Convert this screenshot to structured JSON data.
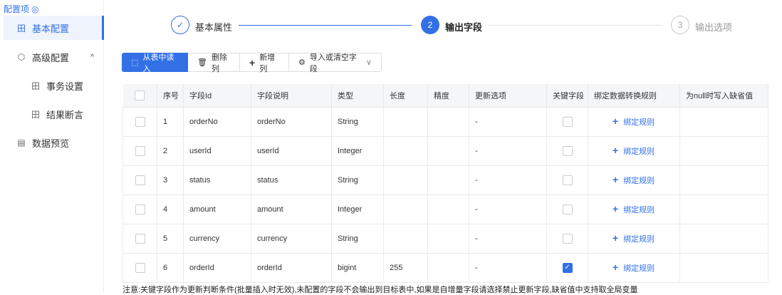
{
  "sidebar": {
    "title": "配置项",
    "items": [
      {
        "label": "基本配置",
        "icon": "grid-icon"
      },
      {
        "label": "高级配置",
        "icon": "cube-icon"
      },
      {
        "label": "事务设置",
        "icon": "grid-icon"
      },
      {
        "label": "结果断言",
        "icon": "grid-icon"
      },
      {
        "label": "数据预览",
        "icon": "preview-icon"
      }
    ]
  },
  "steps": [
    {
      "num": "✓",
      "label": "基本属性",
      "state": "done"
    },
    {
      "num": "2",
      "label": "输出字段",
      "state": "active"
    },
    {
      "num": "3",
      "label": "输出选项",
      "state": "pending"
    }
  ],
  "toolbar": {
    "read": "从表中读入",
    "delete": "删除列",
    "add": "新增列",
    "import": "导入或清空字段"
  },
  "table": {
    "headers": [
      "序号",
      "字段Id",
      "字段说明",
      "类型",
      "长度",
      "精度",
      "更新选项",
      "关键字段",
      "绑定数据转换规则",
      "为null时写入缺省值"
    ],
    "bind_label": "绑定规则",
    "rows": [
      {
        "no": "1",
        "id": "orderNo",
        "desc": "orderNo",
        "type": "String",
        "len": "",
        "prec": "",
        "update": "-",
        "key": false
      },
      {
        "no": "2",
        "id": "userId",
        "desc": "userId",
        "type": "Integer",
        "len": "",
        "prec": "",
        "update": "-",
        "key": false
      },
      {
        "no": "3",
        "id": "status",
        "desc": "status",
        "type": "String",
        "len": "",
        "prec": "",
        "update": "-",
        "key": false
      },
      {
        "no": "4",
        "id": "amount",
        "desc": "amount",
        "type": "Integer",
        "len": "",
        "prec": "",
        "update": "-",
        "key": false
      },
      {
        "no": "5",
        "id": "currency",
        "desc": "currency",
        "type": "String",
        "len": "",
        "prec": "",
        "update": "-",
        "key": false
      },
      {
        "no": "6",
        "id": "orderId",
        "desc": "orderId",
        "type": "bigint",
        "len": "255",
        "prec": "",
        "update": "-",
        "key": true
      }
    ]
  },
  "note": "注意:关键字段作为更新判断条件(批量插入时无效),未配置的字段不会输出到目标表中,如果是自增量字段请选择禁止更新字段,缺省值中支持取全局变量"
}
